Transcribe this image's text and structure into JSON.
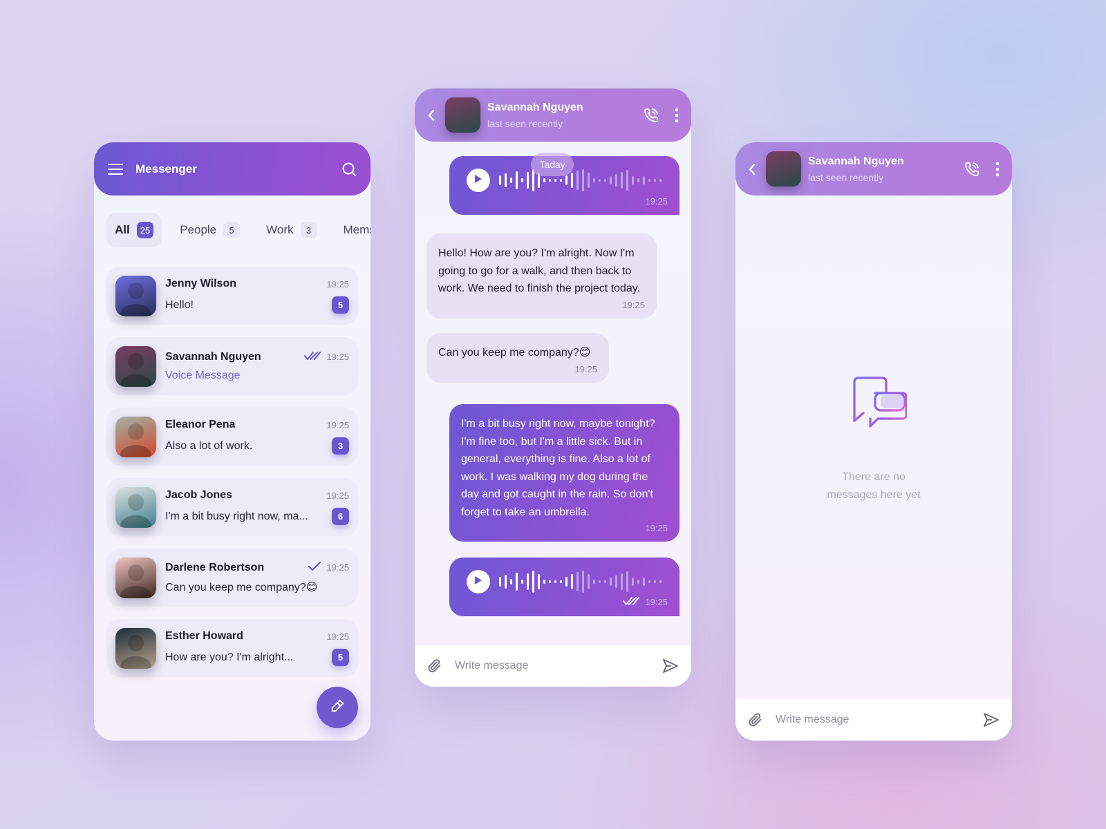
{
  "colors": {
    "accent": "#6a56cf",
    "header_gradient_start": "#6a5ad2",
    "header_gradient_end": "#9a50d0",
    "chat_header_start": "#a98ae2",
    "chat_header_end": "#b67bdc",
    "incoming_bubble": "#e7e1f5",
    "muted_text": "#8e8d9c"
  },
  "list_screen": {
    "title": "Messenger",
    "menu_icon": "hamburger-icon",
    "search_icon": "search-icon",
    "tabs": [
      {
        "label": "All",
        "count": "25",
        "active": true
      },
      {
        "label": "People",
        "count": "5",
        "active": false
      },
      {
        "label": "Work",
        "count": "3",
        "active": false
      },
      {
        "label": "Mems",
        "count": "",
        "active": false
      }
    ],
    "chats": [
      {
        "name": "Jenny Wilson",
        "time": "19:25",
        "preview": "Hello!",
        "unread": "5",
        "status": "",
        "avatar_colors": [
          "#6f6fe0",
          "#2a2f5a"
        ]
      },
      {
        "name": "Savannah Nguyen",
        "time": "19:25",
        "preview": "Voice Message",
        "unread": "",
        "status": "read",
        "avatar_colors": [
          "#7b3c62",
          "#2a4a4a"
        ]
      },
      {
        "name": "Eleanor Pena",
        "time": "19:25",
        "preview": "Also a lot of work.",
        "unread": "3",
        "status": "",
        "avatar_colors": [
          "#9fb3a6",
          "#d8452b"
        ]
      },
      {
        "name": "Jacob Jones",
        "time": "19:25",
        "preview": "I'm a bit busy right now, ma...",
        "unread": "6",
        "status": "",
        "avatar_colors": [
          "#dde3e2",
          "#3d7e8c"
        ]
      },
      {
        "name": "Darlene Robertson",
        "time": "19:25",
        "preview": "Can you keep me company?😊",
        "unread": "",
        "status": "sent",
        "avatar_colors": [
          "#f1c3c0",
          "#3a2820"
        ]
      },
      {
        "name": "Esther Howard",
        "time": "19:25",
        "preview": "How are you? I'm alright...",
        "unread": "5",
        "status": "",
        "avatar_colors": [
          "#1e2a3c",
          "#b7a48a"
        ]
      }
    ],
    "compose_icon": "pencil-icon"
  },
  "chat_screen": {
    "contact_name": "Savannah Nguyen",
    "contact_status": "last seen recently",
    "date_label": "Taday",
    "messages": [
      {
        "type": "voice",
        "direction": "out",
        "time": "19:25",
        "played_fraction": 0.48
      },
      {
        "type": "text",
        "direction": "in",
        "text": "Hello! How are you? I'm alright. Now I'm going to go for a walk, and then back to work. We need to finish the project today.",
        "time": "19:25"
      },
      {
        "type": "text",
        "direction": "in",
        "text": "Can you keep me company?😊",
        "time": "19:25"
      },
      {
        "type": "text",
        "direction": "out",
        "text": "I'm a bit busy right now, maybe tonight? I'm fine too, but I'm a little sick. But in general, everything is fine. Also a lot of work. I was walking my dog during the day and got caught in the rain. So don't forget to take an umbrella.",
        "time": "19:25"
      },
      {
        "type": "voice",
        "direction": "out",
        "time": "19:25",
        "status": "read",
        "played_fraction": 0.48
      }
    ],
    "composer_placeholder": "Write message"
  },
  "empty_screen": {
    "contact_name": "Savannah Nguyen",
    "contact_status": "last seen recently",
    "empty_message_line1": "There are no",
    "empty_message_line2": "messages here yet",
    "composer_placeholder": "Write message"
  }
}
